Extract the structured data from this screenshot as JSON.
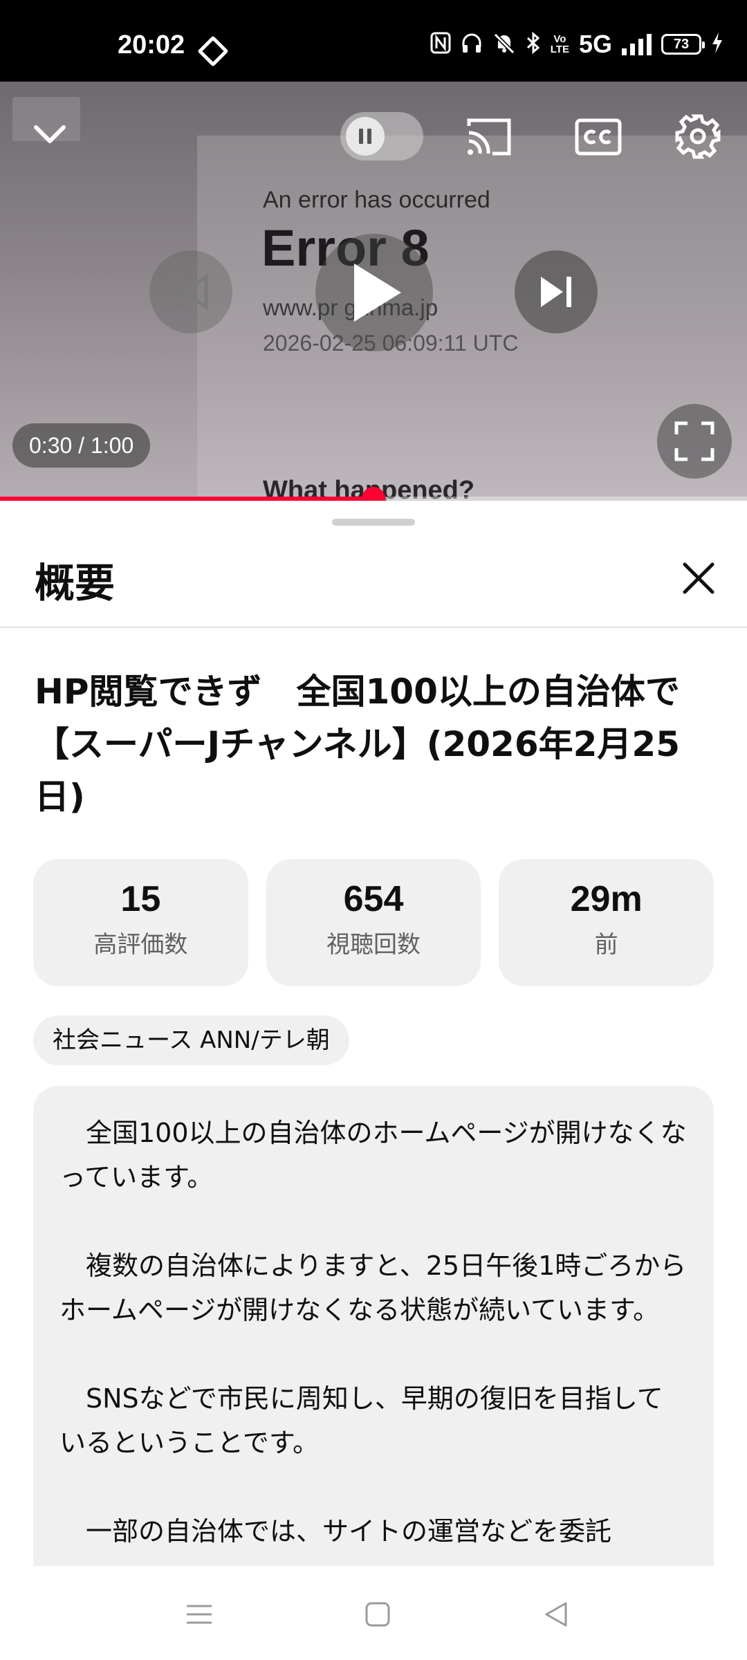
{
  "status_bar": {
    "time": "20:02",
    "network": "5G",
    "volte": "Vo LTE",
    "battery": "73"
  },
  "player": {
    "frame_text": {
      "line1": "An error has occurred",
      "line2": "Error 8",
      "line3": "www.pr   gunma.jp",
      "line4": "2026-02-25 06:09:11 UTC",
      "line5": "What happened?"
    },
    "time_display": "0:30 / 1:00",
    "progress_fraction": 0.5,
    "accent_color": "#ff0033"
  },
  "sheet": {
    "title": "概要",
    "video_title": "HP閲覧できず　全国100以上の自治体で【スーパーJチャンネル】(2026年2月25日)",
    "stats": [
      {
        "value": "15",
        "label": "高評価数"
      },
      {
        "value": "654",
        "label": "視聴回数"
      },
      {
        "value": "29m",
        "label": "前"
      }
    ],
    "tag": "社会ニュース ANN/テレ朝",
    "description": [
      "全国100以上の自治体のホームページが開けなくなっています。",
      "複数の自治体によりますと、25日午後1時ごろからホームページが開けなくなる状態が続いています。",
      "SNSなどで市民に周知し、早期の復旧を目指しているということです。",
      "一部の自治体では、サイトの運営などを委託"
    ]
  }
}
